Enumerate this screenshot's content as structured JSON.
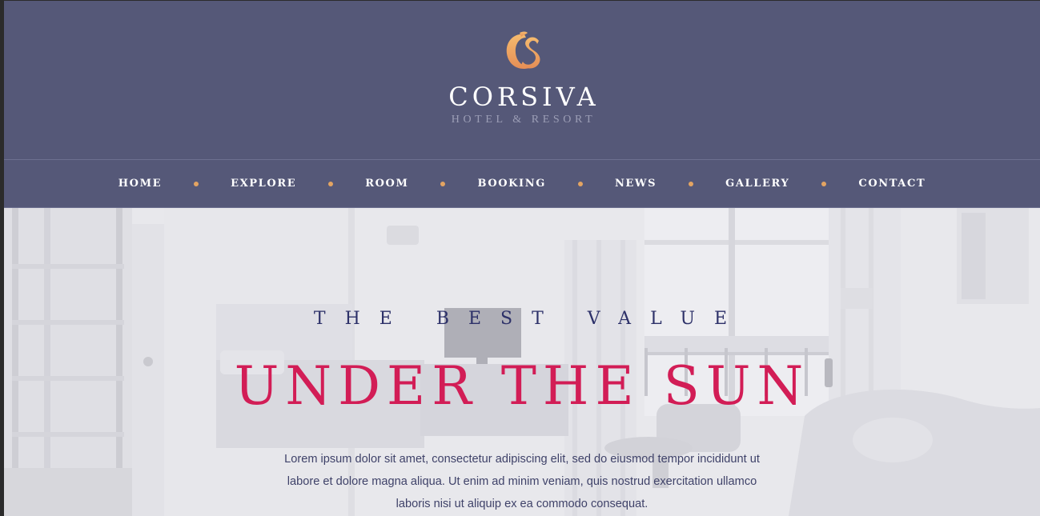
{
  "brand": {
    "name": "CORSIVA",
    "subtitle": "HOTEL & RESORT",
    "logo_icon": "cs-monogram-icon",
    "logo_gradient": [
      "#f6bb6e",
      "#e58e56"
    ]
  },
  "nav": {
    "items": [
      {
        "label": "HOME"
      },
      {
        "label": "EXPLORE"
      },
      {
        "label": "ROOM"
      },
      {
        "label": "BOOKING"
      },
      {
        "label": "NEWS"
      },
      {
        "label": "GALLERY"
      },
      {
        "label": "CONTACT"
      }
    ],
    "separator_color": "#e3a462"
  },
  "hero": {
    "kicker": "THE BEST VALUE",
    "headline": "UNDER THE SUN",
    "lead": "Lorem ipsum dolor sit amet, consectetur adipiscing elit, sed do eiusmod tempor incididunt ut labore et dolore magna aliqua. Ut enim ad minim veniam, quis nostrud exercitation ullamco laboris nisi ut aliquip ex ea commodo consequat.",
    "background": "hotel-room-photo"
  },
  "colors": {
    "header_bg": "#555878",
    "accent": "#d21d56",
    "kicker": "#2d3169",
    "body_text": "#3f4269"
  }
}
